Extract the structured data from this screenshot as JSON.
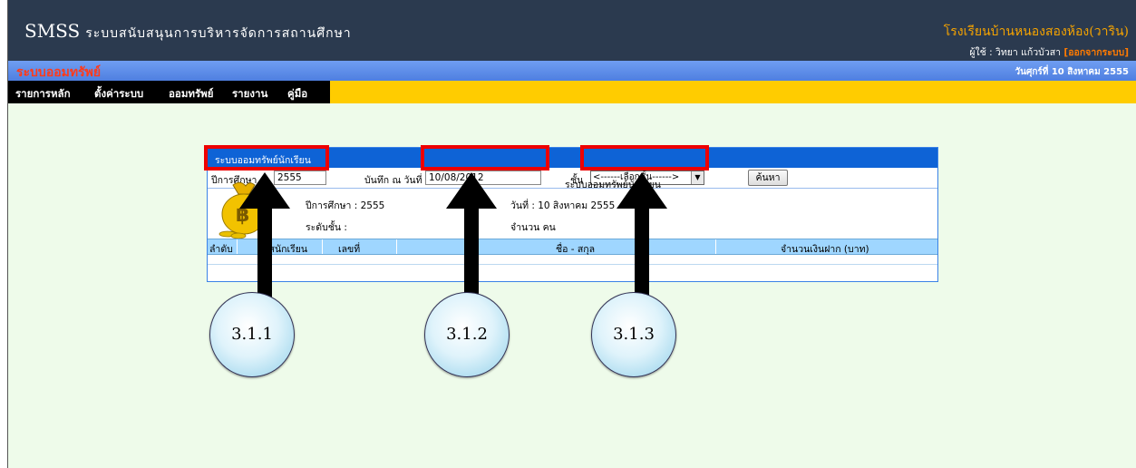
{
  "header": {
    "brand": "SMSS",
    "brand_sub": "ระบบสนับสนุนการบริหารจัดการสถานศึกษา",
    "school": "โรงเรียนบ้านหนองสองห้อง(วาริน)",
    "user_prefix": "ผู้ใช้ : วิทยา แก้วบัวสา",
    "logout": "[ออกจากระบบ]"
  },
  "subheader": {
    "title": "ระบบออมทรัพย์",
    "date": "วันศุกร์ที่ 10 สิงหาคม 2555"
  },
  "menu": [
    "รายการหลัก",
    "ตั้งค่าระบบ",
    "ออมทรัพย์",
    "รายงาน",
    "คู่มือ"
  ],
  "panel": {
    "title": "ระบบออมทรัพย์นักเรียน",
    "year_label": "ปีการศึกษา :",
    "year_value": "2555",
    "date_label": "บันทึก ณ วันที่",
    "date_value": "10/08/2012",
    "class_label": "ชั้น",
    "class_select": "<------เลือกชั้น------>",
    "search_button": "ค้นหา",
    "report_title": "ระบบออมทรัพย์นักเรียน",
    "info_year": "ปีการศึกษา : 2555",
    "info_date": "วันที่ : 10 สิงหาคม 2555",
    "info_level": "ระดับชั้น :",
    "info_count": "จำนวน คน",
    "columns": [
      "ลำดับ",
      "รหัสนักเรียน",
      "เลขที่",
      "ชื่อ - สกุล",
      "จำนวนเงินฝาก (บาท)"
    ]
  },
  "annotations": [
    "3.1.1",
    "3.1.2",
    "3.1.3"
  ],
  "colors": {
    "header_bg": "#2b3a4f",
    "menu_bg": "#ffcc00",
    "panel_head": "#0e63d6",
    "highlight": "#ee0000"
  },
  "icons": [
    "money-bag-icon",
    "dropdown-arrow-icon",
    "up-arrow-icon"
  ]
}
